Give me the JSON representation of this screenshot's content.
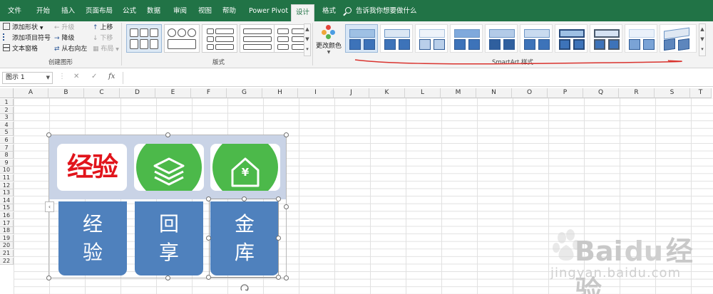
{
  "tabs": [
    {
      "label": "文件",
      "active": false
    },
    {
      "label": "开始",
      "active": false
    },
    {
      "label": "插入",
      "active": false
    },
    {
      "label": "页面布局",
      "active": false
    },
    {
      "label": "公式",
      "active": false
    },
    {
      "label": "数据",
      "active": false
    },
    {
      "label": "审阅",
      "active": false
    },
    {
      "label": "视图",
      "active": false
    },
    {
      "label": "帮助",
      "active": false
    },
    {
      "label": "Power Pivot",
      "active": false
    },
    {
      "label": "设计",
      "active": true
    },
    {
      "label": "格式",
      "active": false
    }
  ],
  "tell_me": "告诉我你想要做什么",
  "ribbon": {
    "create_graphic": {
      "label": "创建图形",
      "add_shape": "添加形状",
      "add_bullet": "添加项目符号",
      "text_pane": "文本窗格",
      "promote": "升级",
      "demote": "降级",
      "right_to_left": "从右向左",
      "move_up": "上移",
      "move_down": "下移",
      "layout": "布局"
    },
    "layouts": {
      "label": "版式"
    },
    "change_colors": "更改颜色",
    "smartart_styles": {
      "label": "SmartArt 样式"
    }
  },
  "formula_bar": {
    "name_box": "图示 1",
    "fx": "fx",
    "cancel": "✕",
    "enter": "✓",
    "value": ""
  },
  "columns": [
    "A",
    "B",
    "C",
    "D",
    "E",
    "F",
    "G",
    "H",
    "I",
    "J",
    "K",
    "L",
    "M",
    "N",
    "O",
    "P",
    "Q",
    "R",
    "S",
    "T"
  ],
  "rows": [
    "1",
    "2",
    "3",
    "4",
    "5",
    "6",
    "7",
    "8",
    "9",
    "10",
    "11",
    "12",
    "13",
    "14",
    "15",
    "16",
    "17",
    "18",
    "19",
    "20",
    "21",
    "22"
  ],
  "smartart": {
    "logo_text": "经验",
    "tiles": [
      {
        "line1": "经",
        "line2": "验"
      },
      {
        "line1": "回",
        "line2": "享"
      },
      {
        "line1": "金",
        "line2": "库"
      }
    ],
    "currency_symbol": "¥"
  },
  "watermark": {
    "brand": "Bai",
    "brand_suffix": "经验",
    "url": "jingyan.baidu.com"
  },
  "colors": {
    "excel_green": "#217346",
    "tile_blue": "#4f81bd",
    "circle_green": "#4cb94a",
    "logo_red": "#e1141b",
    "band": "#c9d3e6",
    "annotation_red": "#d9332e"
  }
}
